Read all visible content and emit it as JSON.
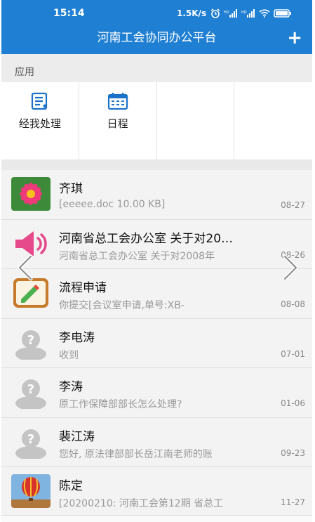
{
  "status_bar": {
    "time": "15:14",
    "net_speed": "1.5K/s"
  },
  "header": {
    "title": "河南工会协同办公平台",
    "add_label": "+"
  },
  "apps_section": {
    "label": "应用",
    "items": [
      {
        "label": "经我处理",
        "icon": "document-list-icon"
      },
      {
        "label": "日程",
        "icon": "calendar-icon"
      }
    ]
  },
  "messages": [
    {
      "name": "齐琪",
      "preview": "[eeeee.doc 10.00 KB]",
      "date": "08-27",
      "avatar": "flower-photo"
    },
    {
      "name": "河南省总工会办公室 关于对20…",
      "preview": "河南省总工会办公室 关于对2008年",
      "date": "08-26",
      "avatar": "speaker-icon"
    },
    {
      "name": "流程申请",
      "preview": "你提交[会议室申请,单号:XB-",
      "date": "08-08",
      "avatar": "notepad-icon"
    },
    {
      "name": "李电涛",
      "preview": "收到",
      "date": "07-01",
      "avatar": "default-user-icon"
    },
    {
      "name": "李涛",
      "preview": "原工作保障部部长怎么处理?",
      "date": "01-06",
      "avatar": "default-user-icon"
    },
    {
      "name": "裴江涛",
      "preview": "您好, 原法律部部长岳江南老师的账",
      "date": "09-23",
      "avatar": "default-user-icon"
    },
    {
      "name": "陈定",
      "preview": "[20200210: 河南工会第12期 省总工",
      "date": "11-27",
      "avatar": "balloon-photo"
    }
  ],
  "colors": {
    "header_bg": "#1f7fd2",
    "app_icon": "#1a73c9"
  }
}
